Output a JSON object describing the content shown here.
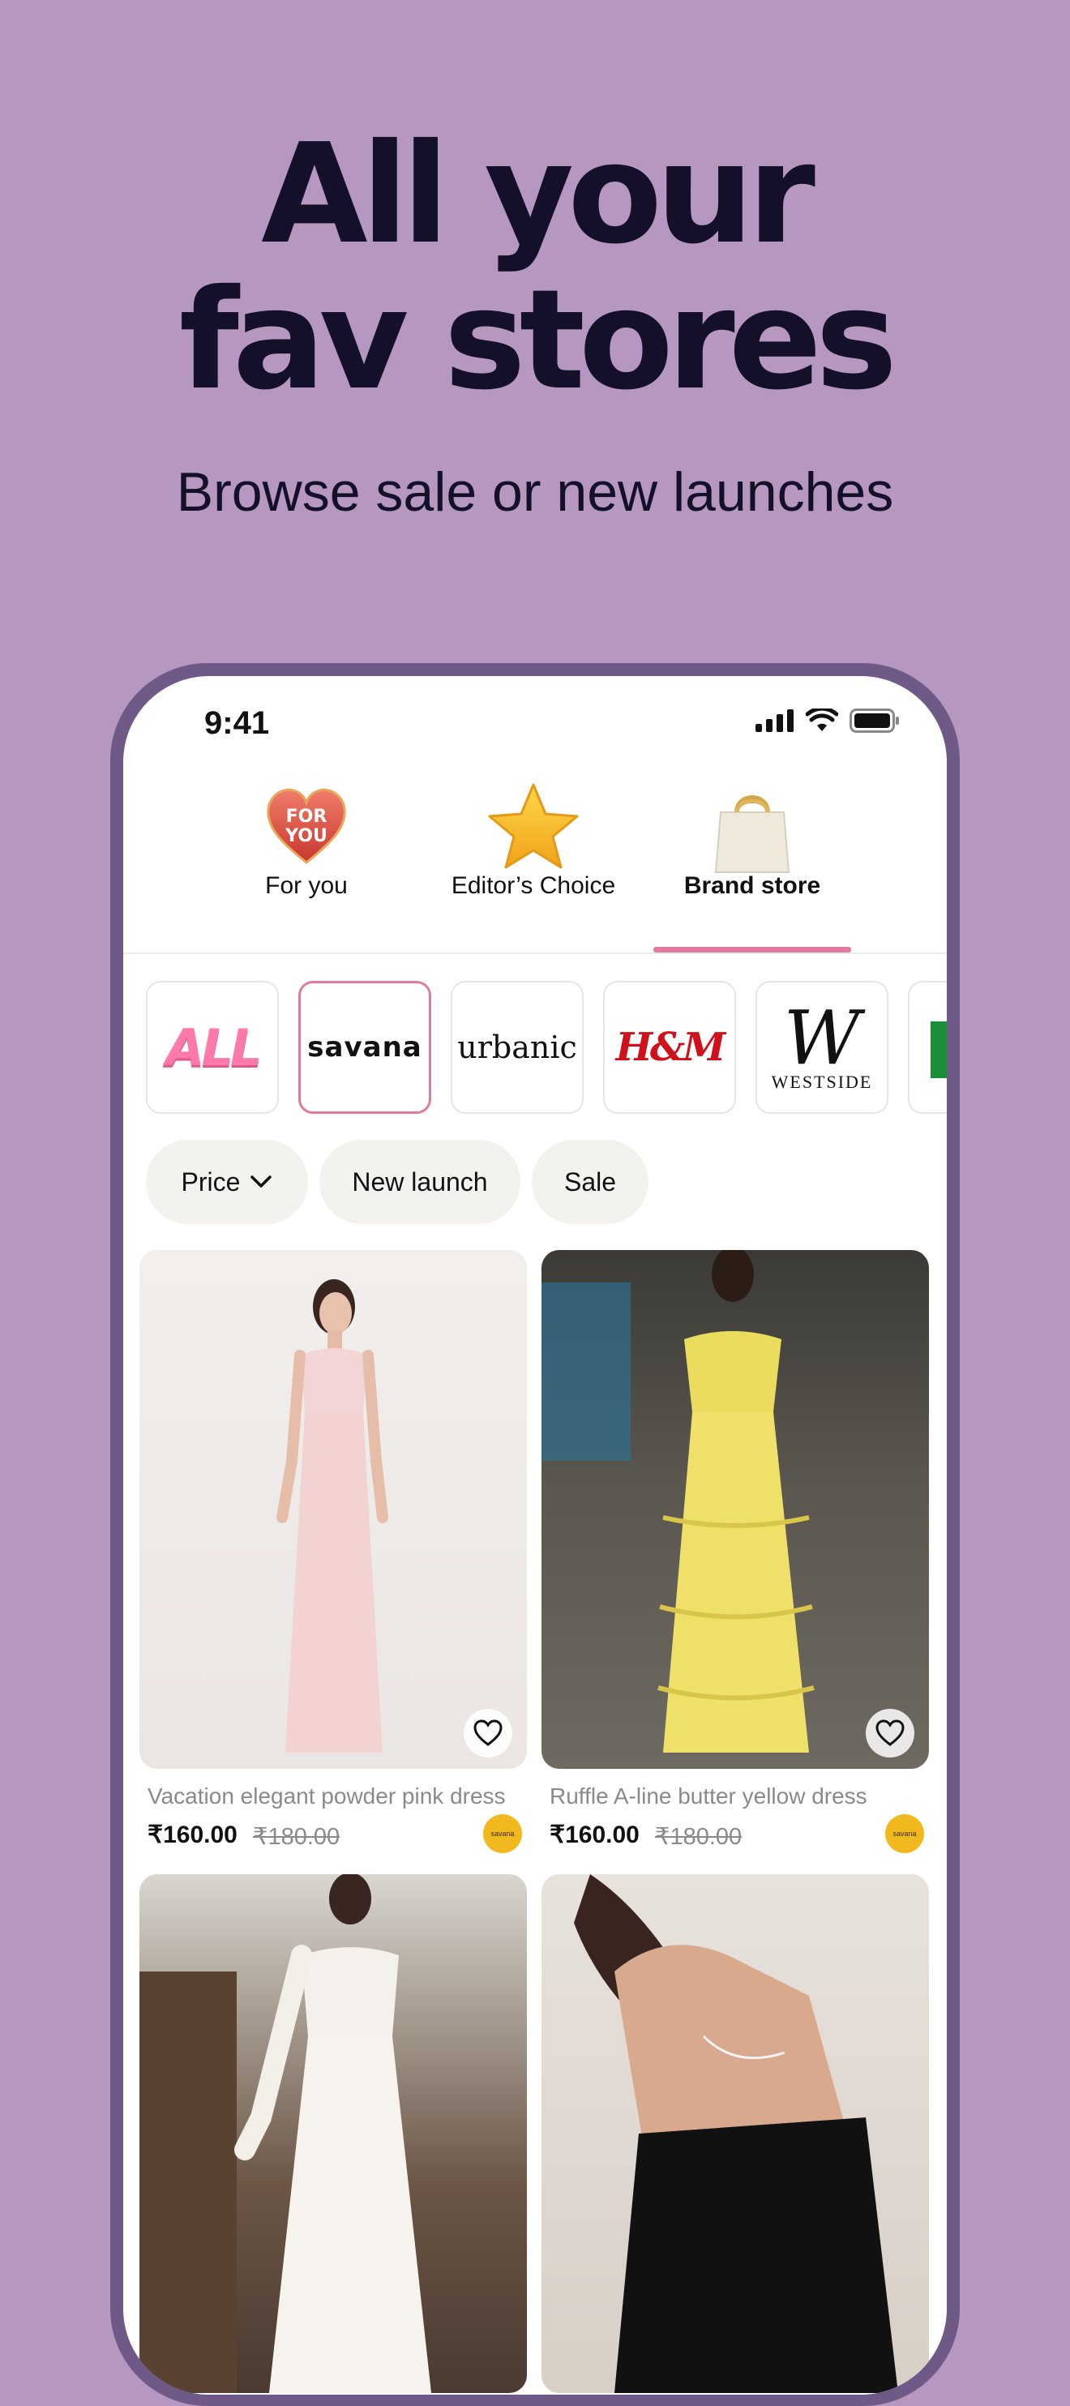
{
  "hero": {
    "title_line1": "All your",
    "title_line2": "fav stores",
    "subtitle": "Browse sale or new launches"
  },
  "status_bar": {
    "time": "9:41"
  },
  "tabs": [
    {
      "label": "For you",
      "icon": "for-you-heart-icon",
      "badge_text": "FOR YOU",
      "active": false
    },
    {
      "label": "Editor’s Choice",
      "icon": "star-icon",
      "active": false
    },
    {
      "label": "Brand store",
      "icon": "shopping-bag-icon",
      "active": true
    }
  ],
  "brands": [
    {
      "label": "ALL",
      "selected": false
    },
    {
      "label": "savana",
      "selected": true
    },
    {
      "label": "urbanic",
      "selected": false
    },
    {
      "label": "H&M",
      "selected": false
    },
    {
      "label": "WESTSIDE",
      "selected": false
    }
  ],
  "filters": [
    {
      "label": "Price",
      "has_dropdown": true
    },
    {
      "label": "New launch"
    },
    {
      "label": "Sale"
    }
  ],
  "products": [
    {
      "name": "Vacation elegant powder pink dress",
      "price": "₹160.00",
      "old_price": "₹180.00",
      "store": "savana"
    },
    {
      "name": "Ruffle A-line butter yellow dress",
      "price": "₹160.00",
      "old_price": "₹180.00",
      "store": "savana"
    },
    {
      "name": "",
      "price": "",
      "old_price": "",
      "store": ""
    },
    {
      "name": "",
      "price": "",
      "old_price": "",
      "store": ""
    }
  ],
  "colors": {
    "background": "#B597BF",
    "accent_pink": "#E07A9F",
    "store_badge": "#F2B91F",
    "phone_frame": "#6F5A87"
  }
}
